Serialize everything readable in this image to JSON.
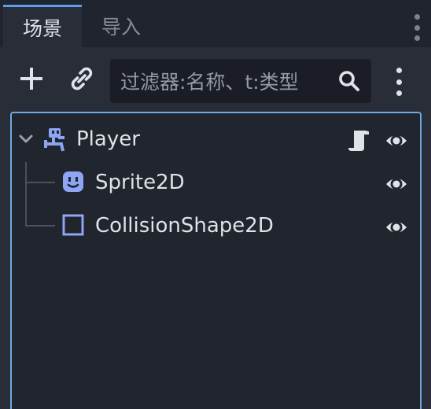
{
  "tabs": [
    {
      "label": "场景",
      "active": true
    },
    {
      "label": "导入",
      "active": false
    }
  ],
  "toolbar": {
    "add_icon": "plus-icon",
    "link_icon": "link-icon",
    "filter_placeholder": "过滤器:名称、t:类型",
    "search_icon": "search-icon",
    "menu_icon": "kebab-menu-icon"
  },
  "tree": {
    "nodes": [
      {
        "name": "Player",
        "icon": "character-body-icon",
        "expanded": true,
        "has_script": true,
        "visible": true,
        "depth": 0
      },
      {
        "name": "Sprite2D",
        "icon": "sprite-icon",
        "visible": true,
        "depth": 1
      },
      {
        "name": "CollisionShape2D",
        "icon": "collision-shape-icon",
        "visible": true,
        "depth": 1
      }
    ]
  },
  "colors": {
    "accent": "#70a8e4",
    "node_icon": "#8da5f3",
    "text": "#dfe2e8",
    "panel_bg": "#21252e"
  }
}
